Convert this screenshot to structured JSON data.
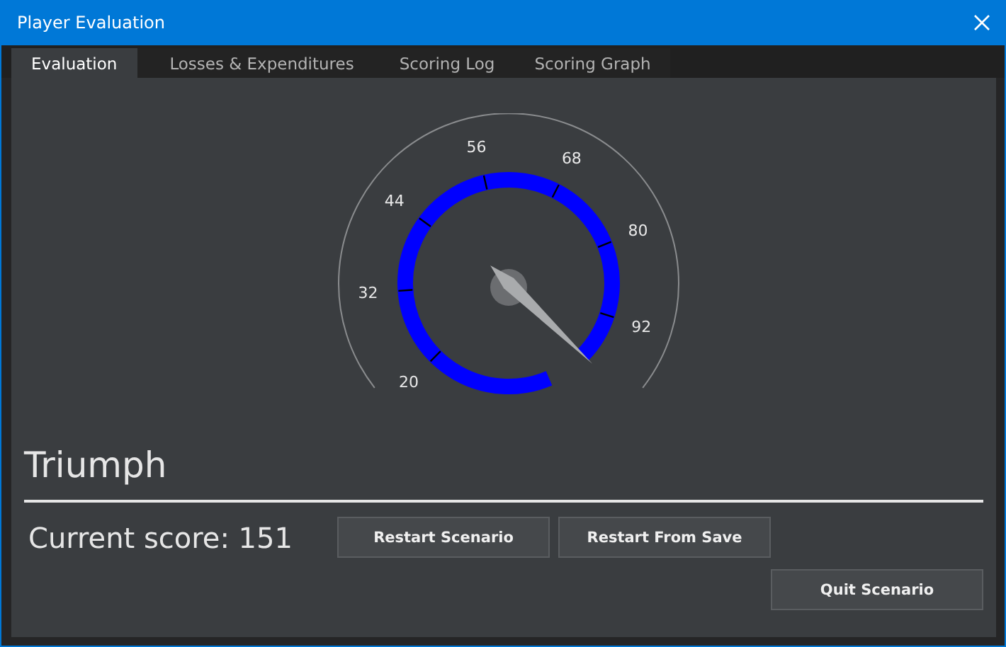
{
  "window": {
    "title": "Player Evaluation"
  },
  "tabs": [
    {
      "label": "Evaluation",
      "selected": true
    },
    {
      "label": "Losses & Expenditures",
      "selected": false
    },
    {
      "label": "Scoring Log",
      "selected": false
    },
    {
      "label": "Scoring Graph",
      "selected": false
    }
  ],
  "gauge": {
    "labels": [
      "20",
      "32",
      "44",
      "56",
      "68",
      "80",
      "92"
    ]
  },
  "result": "Triumph",
  "score": "Current score: 151",
  "buttons": [
    "Restart Scenario",
    "Restart From Save"
  ],
  "quit_button": "Quit Scenario"
}
